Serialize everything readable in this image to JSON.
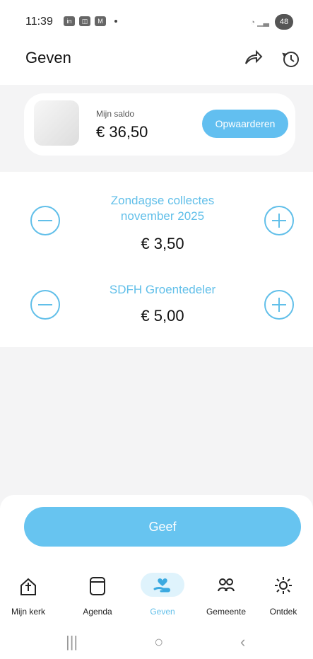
{
  "status_bar": {
    "time": "11:39",
    "icons": [
      "linkedin-icon",
      "photo-icon",
      "mail-icon"
    ],
    "battery": "48"
  },
  "header": {
    "title": "Geven"
  },
  "balance": {
    "label": "Mijn saldo",
    "amount": "€ 36,50",
    "topup_label": "Opwaarderen"
  },
  "donations": [
    {
      "title_line1": "Zondagse collectes",
      "title_line2": "november 2025",
      "amount": "€ 3,50"
    },
    {
      "title_line1": "SDFH Groentedeler",
      "amount": "€ 5,00"
    }
  ],
  "action": {
    "label": "Geef"
  },
  "bottom_nav": [
    {
      "label": "Mijn kerk"
    },
    {
      "label": "Agenda"
    },
    {
      "label": "Geven"
    },
    {
      "label": "Gemeente"
    },
    {
      "label": "Ontdek"
    }
  ],
  "colors": {
    "accent": "#61BFE9",
    "button": "#67C4F0",
    "background": "#F4F4F5"
  }
}
